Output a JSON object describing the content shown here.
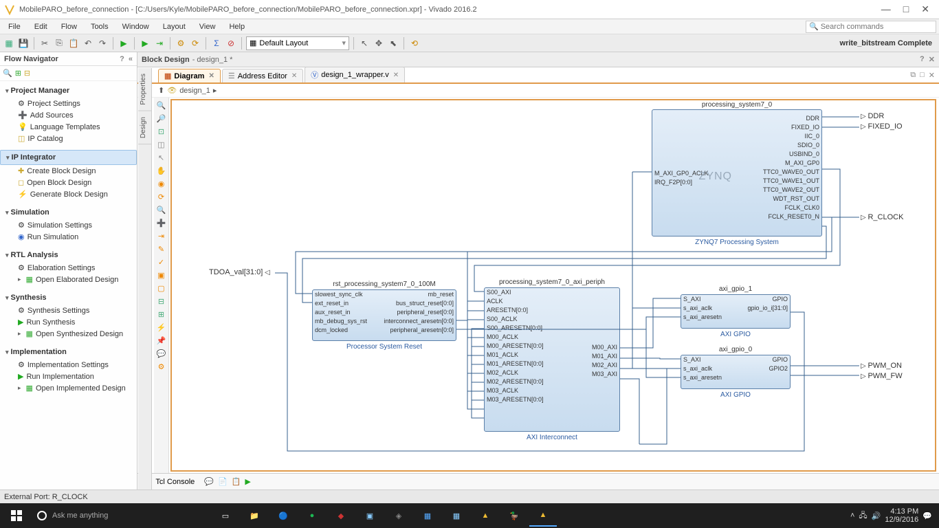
{
  "window": {
    "title": "MobilePARO_before_connection - [C:/Users/Kyle/MobilePARO_before_connection/MobilePARO_before_connection.xpr] - Vivado 2016.2"
  },
  "menu": {
    "items": [
      "File",
      "Edit",
      "Flow",
      "Tools",
      "Window",
      "Layout",
      "View",
      "Help"
    ],
    "search_placeholder": "Search commands"
  },
  "toolbar": {
    "layout": "Default Layout",
    "status": "write_bitstream Complete"
  },
  "flow_nav": {
    "title": "Flow Navigator",
    "sections": [
      {
        "title": "Project Manager",
        "items": [
          "Project Settings",
          "Add Sources",
          "Language Templates",
          "IP Catalog"
        ]
      },
      {
        "title": "IP Integrator",
        "selected": true,
        "items": [
          "Create Block Design",
          "Open Block Design",
          "Generate Block Design"
        ]
      },
      {
        "title": "Simulation",
        "items": [
          "Simulation Settings",
          "Run Simulation"
        ]
      },
      {
        "title": "RTL Analysis",
        "items": [
          "Elaboration Settings",
          "Open Elaborated Design"
        ],
        "last_expand": true
      },
      {
        "title": "Synthesis",
        "items": [
          "Synthesis Settings",
          "Run Synthesis",
          "Open Synthesized Design"
        ],
        "last_expand": true
      },
      {
        "title": "Implementation",
        "items": [
          "Implementation Settings",
          "Run Implementation",
          "Open Implemented Design"
        ],
        "last_expand": true
      }
    ]
  },
  "block_design": {
    "header": "Block Design",
    "sub": "- design_1 *"
  },
  "tabs": [
    {
      "label": "Diagram",
      "active": true
    },
    {
      "label": "Address Editor"
    },
    {
      "label": "design_1_wrapper.v"
    }
  ],
  "breadcrumb": "design_1",
  "side_tabs": [
    "Properties",
    "Design"
  ],
  "blocks": {
    "ps7": {
      "name": "processing_system7_0",
      "footer": "ZYNQ7 Processing System",
      "logo": "ZYNQ",
      "left": [
        "M_AXI_GP0_ACLK",
        "IRQ_F2P[0:0]"
      ],
      "right": [
        "DDR",
        "FIXED_IO",
        "IIC_0",
        "SDIO_0",
        "USBIND_0",
        "M_AXI_GP0",
        "TTC0_WAVE0_OUT",
        "TTC0_WAVE1_OUT",
        "TTC0_WAVE2_OUT",
        "WDT_RST_OUT",
        "FCLK_CLK0",
        "FCLK_RESET0_N"
      ]
    },
    "rst": {
      "name": "rst_processing_system7_0_100M",
      "footer": "Processor System Reset",
      "left": [
        "slowest_sync_clk",
        "ext_reset_in",
        "aux_reset_in",
        "mb_debug_sys_rst",
        "dcm_locked"
      ],
      "right": [
        "mb_reset",
        "bus_struct_reset[0:0]",
        "peripheral_reset[0:0]",
        "interconnect_aresetn[0:0]",
        "peripheral_aresetn[0:0]"
      ]
    },
    "axi_ic": {
      "name": "processing_system7_0_axi_periph",
      "footer": "AXI Interconnect",
      "left": [
        "S00_AXI",
        "ACLK",
        "ARESETN[0:0]",
        "S00_ACLK",
        "S00_ARESETN[0:0]",
        "M00_ACLK",
        "M00_ARESETN[0:0]",
        "M01_ACLK",
        "M01_ARESETN[0:0]",
        "M02_ACLK",
        "M02_ARESETN[0:0]",
        "M03_ACLK",
        "M03_ARESETN[0:0]"
      ],
      "right": [
        "M00_AXI",
        "M01_AXI",
        "M02_AXI",
        "M03_AXI"
      ]
    },
    "gpio1": {
      "name": "axi_gpio_1",
      "footer": "AXI GPIO",
      "left": [
        "S_AXI",
        "s_axi_aclk",
        "s_axi_aresetn"
      ],
      "right": [
        "GPIO",
        "gpio_io_i[31:0]"
      ]
    },
    "gpio0": {
      "name": "axi_gpio_0",
      "footer": "AXI GPIO",
      "left": [
        "S_AXI",
        "s_axi_aclk",
        "s_axi_aresetn"
      ],
      "right": [
        "GPIO",
        "GPIO2"
      ]
    }
  },
  "ext_ports": {
    "tdoa": "TDOA_val[31:0]",
    "ddr": "DDR",
    "fixed_io": "FIXED_IO",
    "r_clock": "R_CLOCK",
    "pwm_on": "PWM_ON",
    "pwm_fw": "PWM_FW"
  },
  "tcl": "Tcl Console",
  "status_bar": "External Port: R_CLOCK",
  "taskbar": {
    "cortana": "Ask me anything",
    "time": "4:13 PM",
    "date": "12/9/2016"
  }
}
